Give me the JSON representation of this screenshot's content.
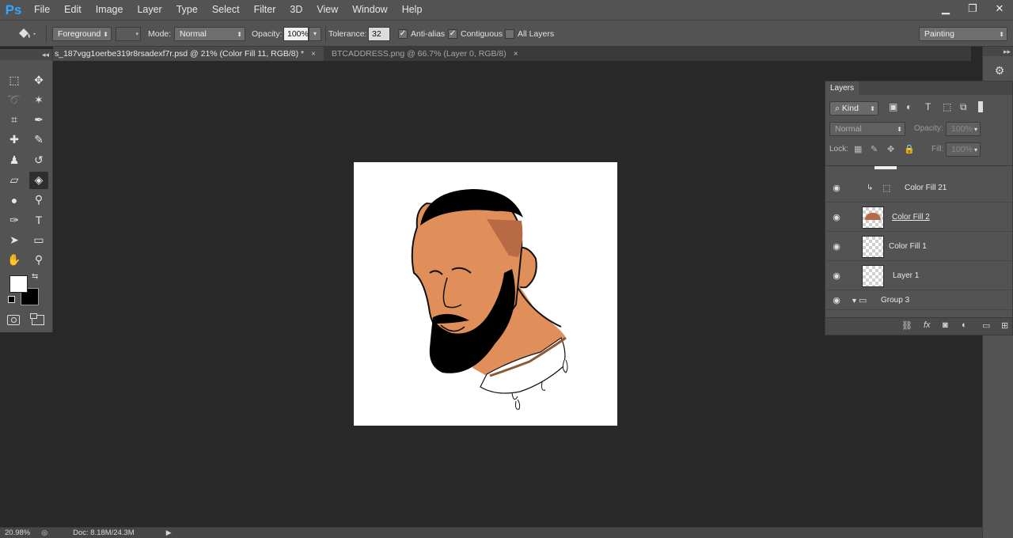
{
  "app": {
    "logo": "Ps"
  },
  "menu": [
    "File",
    "Edit",
    "Image",
    "Layer",
    "Type",
    "Select",
    "Filter",
    "3D",
    "View",
    "Window",
    "Help"
  ],
  "window_controls": {
    "minimize": "▁",
    "restore": "❐",
    "close": "✕"
  },
  "options": {
    "fill_source": "Foreground",
    "mode_label": "Mode:",
    "mode_value": "Normal",
    "opacity_label": "Opacity:",
    "opacity_value": "100%",
    "tolerance_label": "Tolerance:",
    "tolerance_value": "32",
    "antialias_label": "Anti-alias",
    "contiguous_label": "Contiguous",
    "all_layers_label": "All Layers",
    "workspace": "Painting"
  },
  "tabs": [
    {
      "label": "s_187vgg1oerbe319r8rsadexf7r.psd @ 21% (Color Fill 11, RGB/8) *",
      "close": "×"
    },
    {
      "label": "BTCADDRESS.png @ 66.7% (Layer 0, RGB/8)",
      "close": "×"
    }
  ],
  "toolbar_collapse": "◂◂",
  "tools": [
    "rectangular-marquee-icon",
    "move-icon",
    "lasso-icon",
    "magic-wand-icon",
    "crop-icon",
    "eyedropper-icon",
    "healing-brush-icon",
    "brush-icon",
    "clone-stamp-icon",
    "history-brush-icon",
    "eraser-icon",
    "paint-bucket-icon",
    "blur-icon",
    "dodge-icon",
    "pen-icon",
    "type-icon",
    "path-selection-icon",
    "rectangle-icon",
    "hand-icon",
    "zoom-icon"
  ],
  "colors": {
    "foreground": "#ffffff",
    "background": "#000000"
  },
  "layers_panel": {
    "tab": "Layers",
    "filter_kind": "Kind",
    "blend_mode": "Normal",
    "opacity_label": "Opacity:",
    "opacity_value": "100%",
    "lock_label": "Lock:",
    "fill_label": "Fill:",
    "fill_value": "100%",
    "layers": [
      {
        "name": "Color Fill 21",
        "visible": true
      },
      {
        "name": "Color Fill 2",
        "visible": true
      },
      {
        "name": "Color Fill 1",
        "visible": true
      },
      {
        "name": "Layer 1",
        "visible": true
      },
      {
        "name": "Group 3",
        "visible": true
      }
    ]
  },
  "status": {
    "zoom": "20.98%",
    "doc": "Doc: 8.18M/24.3M"
  }
}
